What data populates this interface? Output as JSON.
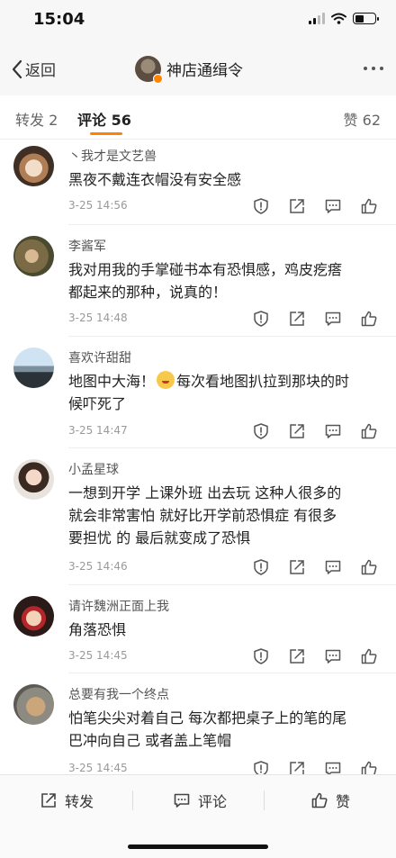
{
  "status_bar": {
    "time": "15:04"
  },
  "nav": {
    "back_label": "返回",
    "title": "神店通缉令"
  },
  "tabs": {
    "repost": "转发 2",
    "comments": "评论 56",
    "likes": "赞 62"
  },
  "comments": [
    {
      "username": "丶我才是文艺兽",
      "lines": [
        "黑夜不戴连衣帽没有安全感"
      ],
      "time": "3-25 14:56"
    },
    {
      "username": "李酱军",
      "lines": [
        "我对用我的手掌碰书本有恐惧感，鸡皮疙瘩",
        "都起来的那种，说真的！"
      ],
      "time": "3-25 14:48"
    },
    {
      "username": "喜欢许甜甜",
      "line1_a": "地图中大海！",
      "line1_b": "每次看地图扒拉到那块的时",
      "line2": "候吓死了",
      "time": "3-25 14:47"
    },
    {
      "username": "小孟星球",
      "lines": [
        "一想到开学 上课外班 出去玩 这种人很多的",
        "就会非常害怕 就好比开学前恐惧症 有很多",
        "要担忧 的 最后就变成了恐惧"
      ],
      "time": "3-25 14:46"
    },
    {
      "username": "请许魏洲正面上我",
      "lines": [
        "角落恐惧"
      ],
      "time": "3-25 14:45"
    },
    {
      "username": "总要有我一个终点",
      "lines": [
        "怕笔尖尖对着自己 每次都把桌子上的笔的尾",
        "巴冲向自己 或者盖上笔帽"
      ],
      "time": "3-25 14:45"
    }
  ],
  "bottom_bar": {
    "repost": "转发",
    "comment": "评论",
    "like": "赞"
  },
  "colors": {
    "accent": "#ff8200",
    "divider": "#eeeeee",
    "time_text": "#9a9a9a"
  },
  "icons": [
    "back-chevron-icon",
    "more-icon",
    "report-icon",
    "share-icon",
    "comment-icon",
    "like-icon"
  ]
}
